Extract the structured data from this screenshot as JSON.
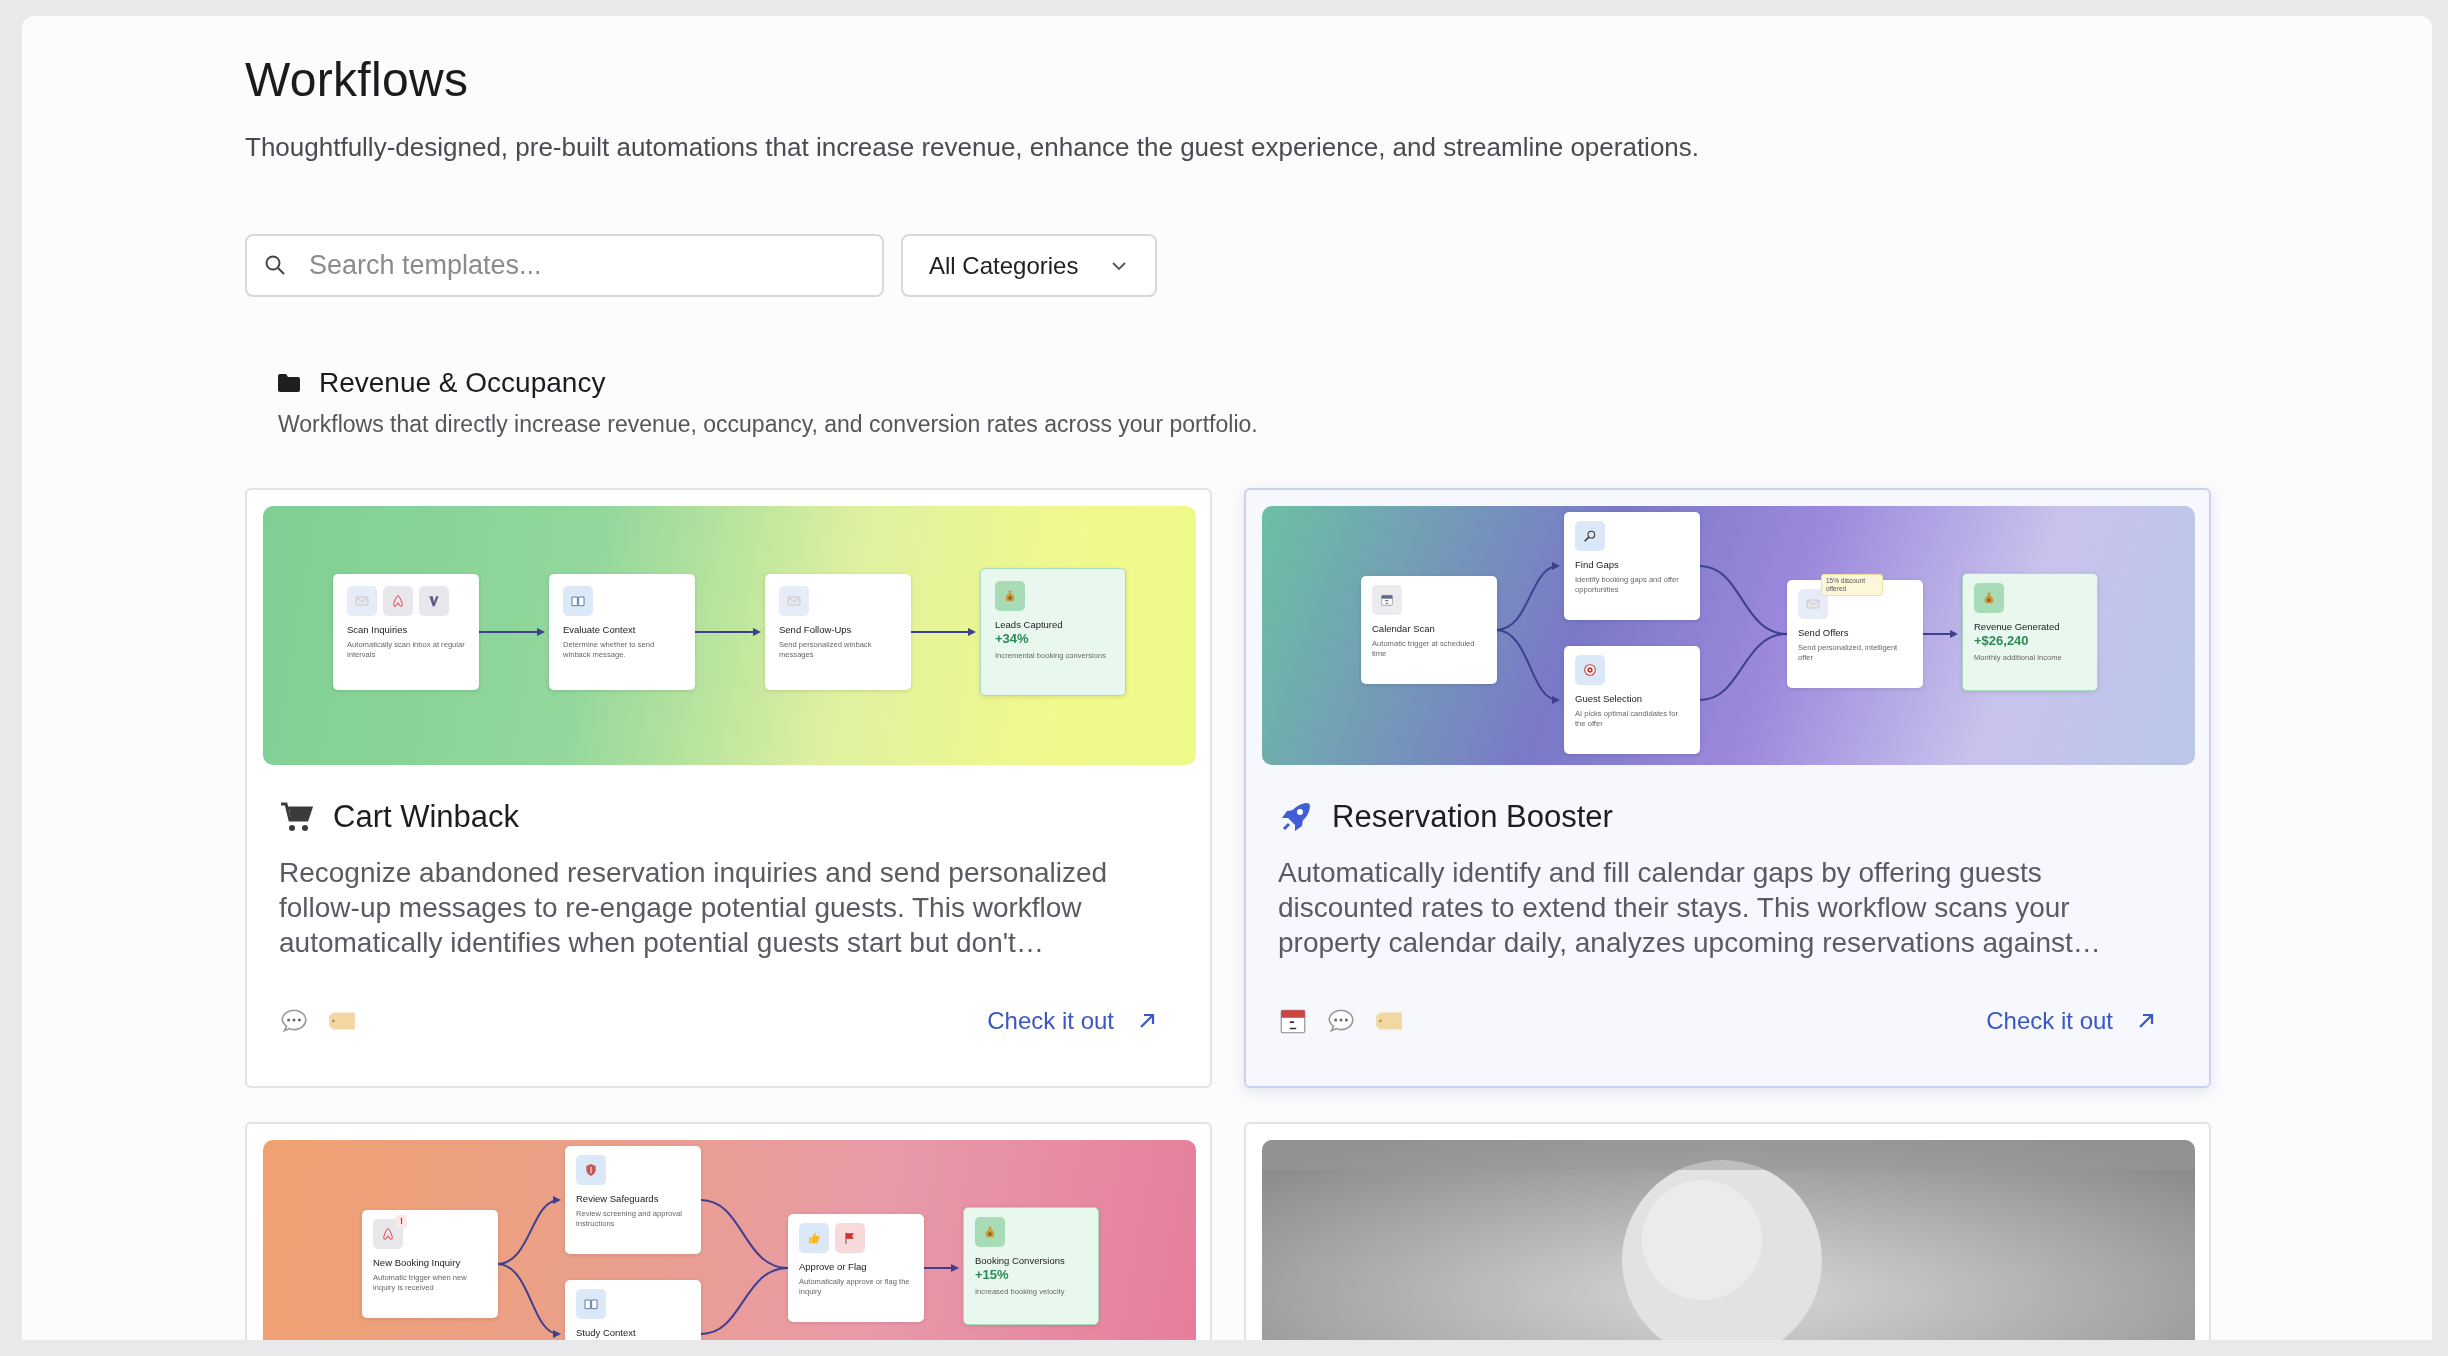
{
  "header": {
    "title": "Workflows",
    "subtitle": "Thoughtfully-designed, pre-built automations that increase revenue, enhance the guest experience, and streamline operations."
  },
  "filters": {
    "search": {
      "placeholder": "Search templates..."
    },
    "category": {
      "value": "All Categories"
    }
  },
  "section": {
    "title": "Revenue & Occupancy",
    "description": "Workflows that directly increase revenue, occupancy, and conversion rates across your portfolio."
  },
  "cards": [
    {
      "kind": "diagram",
      "hovered": false,
      "title": "Cart Winback",
      "description": "Recognize abandoned reservation inquiries and send personalized follow-up messages to re-engage potential guests. This workflow automatically identifies when potential guests start but don't…",
      "link": "Check it out",
      "diagram": {
        "nodes": [
          {
            "kind": "step",
            "title": "Scan Inquiries",
            "desc": "Automatically scan inbox at regular intervals"
          },
          {
            "kind": "step",
            "title": "Evaluate Context",
            "desc": "Determine whether to send winback message."
          },
          {
            "kind": "step",
            "title": "Send Follow-Ups",
            "desc": "Send personalized winback messages"
          },
          {
            "kind": "result",
            "title": "Leads Captured",
            "value": "+34%",
            "desc": "Incremental booking conversions"
          }
        ]
      }
    },
    {
      "kind": "diagram",
      "hovered": true,
      "title": "Reservation Booster",
      "description": "Automatically identify and fill calendar gaps by offering guests discounted rates to extend their stays. This workflow scans your property calendar daily, analyzes upcoming reservations against…",
      "link": "Check it out",
      "diagram": {
        "nodes": [
          {
            "kind": "step",
            "title": "Calendar Scan",
            "desc": "Automatic trigger at scheduled time"
          },
          {
            "kind": "step",
            "title": "Find Gaps",
            "desc": "Identify booking gaps and offer opportunities"
          },
          {
            "kind": "step",
            "title": "Guest Selection",
            "desc": "AI picks optimal candidates for the offer"
          },
          {
            "kind": "step",
            "title": "Send Offers",
            "desc": "Send personalized, intelligent offer",
            "badge": "15% discount offered"
          },
          {
            "kind": "result",
            "title": "Revenue Generated",
            "value": "+$26,240",
            "desc": "Monthly additional income"
          }
        ]
      }
    },
    {
      "kind": "diagram",
      "hovered": false,
      "diagram": {
        "nodes": [
          {
            "kind": "step",
            "title": "New Booking Inquiry",
            "desc": "Automatic trigger when new inquiry is received",
            "alert": "!"
          },
          {
            "kind": "step",
            "title": "Review Safeguards",
            "desc": "Review screening and approval instructions"
          },
          {
            "kind": "step",
            "title": "Study Context"
          },
          {
            "kind": "step",
            "title": "Approve or Flag",
            "desc": "Automatically approve or flag the inquiry"
          },
          {
            "kind": "result",
            "title": "Booking Conversions",
            "value": "+15%",
            "desc": "Increased booking velocity"
          }
        ]
      }
    },
    {
      "kind": "picture",
      "hovered": false
    }
  ]
}
